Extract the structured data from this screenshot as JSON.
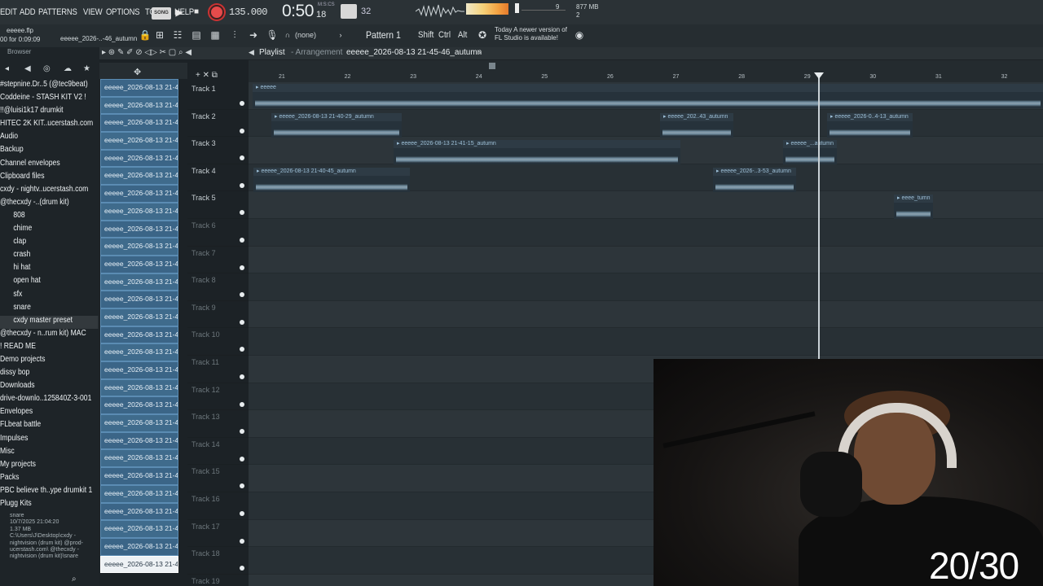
{
  "menu": [
    "EDIT",
    "ADD",
    "PATTERNS",
    "VIEW",
    "OPTIONS",
    "TOOLS",
    "HELP"
  ],
  "song_badge": "SONG",
  "tempo": "135.000",
  "clock": {
    "main": "0:50",
    "frac": "18",
    "label": "M:S:CS"
  },
  "bits": "32",
  "cpu": "9",
  "memory": {
    "mb": "877 MB",
    "count": "2"
  },
  "project": {
    "file": "eeeee.flp",
    "time": "00 for 0:09:09",
    "playlist_short": "eeeee_2026-..-46_autumn"
  },
  "toolbar": {
    "snap": "(none)",
    "pattern": "Pattern 1",
    "shift": "Shift",
    "ctrl": "Ctrl",
    "alt": "Alt"
  },
  "news": {
    "line1": "Today  A newer version of",
    "line2": "FL Studio is available!"
  },
  "browser": {
    "title": "Browser",
    "folders": [
      {
        "label": "#stepnine.Dr..5 (@tec9beat)",
        "sub": false
      },
      {
        "label": "Coddeine - STASH KIT V2 !",
        "sub": false
      },
      {
        "label": "!!@luisi1k17 drumkit",
        "sub": false
      },
      {
        "label": "HITEC 2K KIT..ucerstash.com",
        "sub": false
      },
      {
        "label": "Audio",
        "sub": false
      },
      {
        "label": "Backup",
        "sub": false
      },
      {
        "label": "Channel envelopes",
        "sub": false
      },
      {
        "label": "Clipboard files",
        "sub": false
      },
      {
        "label": "cxdy - nightv..ucerstash.com",
        "sub": false
      },
      {
        "label": "@thecxdy -..(drum kit)",
        "sub": false
      },
      {
        "label": "808",
        "sub": true
      },
      {
        "label": "chime",
        "sub": true
      },
      {
        "label": "clap",
        "sub": true
      },
      {
        "label": "crash",
        "sub": true
      },
      {
        "label": "hi hat",
        "sub": true
      },
      {
        "label": "open hat",
        "sub": true
      },
      {
        "label": "sfx",
        "sub": true
      },
      {
        "label": "snare",
        "sub": true
      },
      {
        "label": "cxdy master preset",
        "sub": true
      },
      {
        "label": "@thecxdy - n..rum kit) MAC",
        "sub": false
      },
      {
        "label": "! READ ME",
        "sub": false
      },
      {
        "label": "Demo projects",
        "sub": false
      },
      {
        "label": "dissy bop",
        "sub": false
      },
      {
        "label": "Downloads",
        "sub": false
      },
      {
        "label": "drive-downlo..125840Z-3-001",
        "sub": false
      },
      {
        "label": "Envelopes",
        "sub": false
      },
      {
        "label": "FLbeat battle",
        "sub": false
      },
      {
        "label": "Impulses",
        "sub": false
      },
      {
        "label": "Misc",
        "sub": false
      },
      {
        "label": "My projects",
        "sub": false
      },
      {
        "label": "Packs",
        "sub": false
      },
      {
        "label": "PBC believe th..ype drumkit 1",
        "sub": false
      },
      {
        "label": "Plugg Kits",
        "sub": false
      }
    ],
    "info": {
      "name": "snare",
      "date": "10/7/2025 21:04:20",
      "size": "1.37 MB",
      "path": "C:\\Users\\J\\Desktop\\cxdy - nightvision (drum kit) @prod-ucerstash.com\\ @thecxdy - nightvision (drum kit)\\snare"
    }
  },
  "clip_label": "eeeee_2026-08-13 21-4...",
  "playlist": {
    "title": "Playlist",
    "sep": "- Arrangement",
    "file": "eeeee_2026-08-13 21-45-46_autumn"
  },
  "ruler": [
    "21",
    "22",
    "23",
    "24",
    "25",
    "26",
    "27",
    "28",
    "29",
    "30",
    "31",
    "32"
  ],
  "tracks": [
    "Track 1",
    "Track 2",
    "Track 3",
    "Track 4",
    "Track 5",
    "Track 6",
    "Track 7",
    "Track 8",
    "Track 9",
    "Track 10",
    "Track 11",
    "Track 12",
    "Track 13",
    "Track 14",
    "Track 15",
    "Track 16",
    "Track 17",
    "Track 18",
    "Track 19"
  ],
  "audio_clips": [
    {
      "label": "eeeee",
      "track": 1
    },
    {
      "label": "eeeee_2026-08-13 21-40-29_autumn",
      "track": 2
    },
    {
      "label": "eeeee_202..43_autumn",
      "track": 2
    },
    {
      "label": "eeeee_2026-0..4-13_autumn",
      "track": 2
    },
    {
      "label": "eeeee_2026-08-13 21-41-15_autumn",
      "track": 3
    },
    {
      "label": "eeeee_...autumn",
      "track": 3
    },
    {
      "label": "eeeee_2026-08-13 21-40-45_autumn",
      "track": 4
    },
    {
      "label": "eeeee_2026-..3-53_autumn",
      "track": 4
    },
    {
      "label": "eeee_tumn",
      "track": 5
    }
  ],
  "overlay_counter": "20/30",
  "colors": {
    "accent": "#3f6b8c",
    "record": "#e64b4b"
  }
}
